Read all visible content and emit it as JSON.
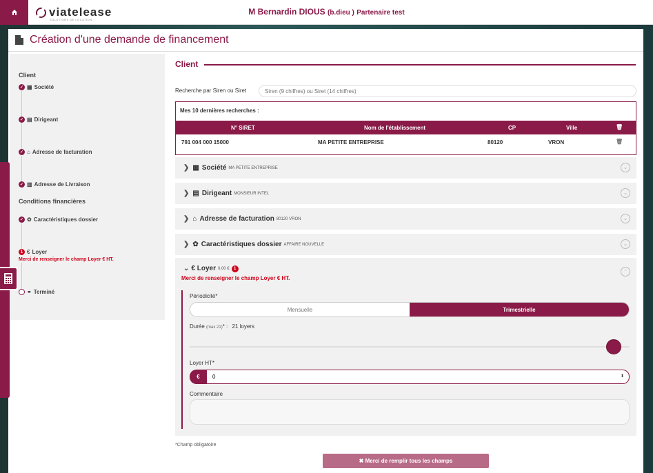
{
  "header": {
    "home_icon": "home-icon",
    "logo_text": "viatelease",
    "logo_tag": "SOLUTIONS DE LOCATION",
    "user_name": "M Bernardin DIOUS",
    "user_login": "(b.dieu )",
    "partner": "Partenaire test"
  },
  "page": {
    "title": "Création d'une demande de financement"
  },
  "stepper": {
    "group_client": "Client",
    "group_conditions": "Conditions financières",
    "items": [
      {
        "label": "Société",
        "icon": "building-icon",
        "state": "done"
      },
      {
        "label": "Dirigeant",
        "icon": "id-card-icon",
        "state": "done"
      },
      {
        "label": "Adresse de facturation",
        "icon": "home-icon",
        "state": "done"
      },
      {
        "label": "Adresse de Livraison",
        "icon": "building-icon",
        "state": "done"
      },
      {
        "label": "Caractéristiques dossier",
        "icon": "gear-icon",
        "state": "done"
      },
      {
        "label": "Loyer",
        "icon": "euro-icon",
        "state": "error",
        "badge": "1"
      },
      {
        "label": "Terminé",
        "icon": "handshake-icon",
        "state": "pending"
      }
    ],
    "loyer_error": "Merci de renseigner le champ Loyer € HT."
  },
  "client": {
    "section_title": "Client",
    "search_label": "Recherche par Siren ou Siret",
    "search_placeholder": "Siren (9 chiffres) ou Siret (14 chiffres)",
    "recent_title": "Mes 10 dernières recherches :",
    "columns": [
      "N° SIRET",
      "Nom de l'établissement",
      "CP",
      "Ville"
    ],
    "rows": [
      {
        "siret": "791 004 000 15000",
        "name": "MA PETITE ENTREPRISE",
        "cp": "80120",
        "ville": "VRON"
      }
    ]
  },
  "accordions": [
    {
      "label": "Société",
      "sub": "MA PETITE ENTREPRISE",
      "icon": "building-icon"
    },
    {
      "label": "Dirigeant",
      "sub": "MONSIEUR INTEL",
      "icon": "id-card-icon"
    },
    {
      "label": "Adresse de facturation",
      "sub": "80120 VRON",
      "icon": "home-icon"
    },
    {
      "label": "Caractéristiques dossier",
      "sub": "AFFAIRE NOUVELLE",
      "icon": "gear-icon"
    }
  ],
  "loyer": {
    "title": "€ Loyer",
    "amount": "0,00 €",
    "badge": "1",
    "error": "Merci de renseigner le champ Loyer € HT.",
    "periodicite_label": "Périodicité*",
    "options": [
      "Mensuelle",
      "Trimestrielle"
    ],
    "selected": "Trimestrielle",
    "duree_label": "Durée",
    "duree_max": "(max 21)",
    "duree_star": "* :",
    "duree_value": "21 loyers",
    "duree_fraction": 1.0,
    "loyer_ht_label": "Loyer HT*",
    "currency": "€",
    "loyer_value": "0",
    "commentaire_label": "Commentaire"
  },
  "footer": {
    "required_note": "*Champ obligatoire",
    "submit_label": "✖ Merci de remplir tous les champs"
  },
  "colors": {
    "brand": "#8a1a47",
    "error": "#d0021b"
  }
}
